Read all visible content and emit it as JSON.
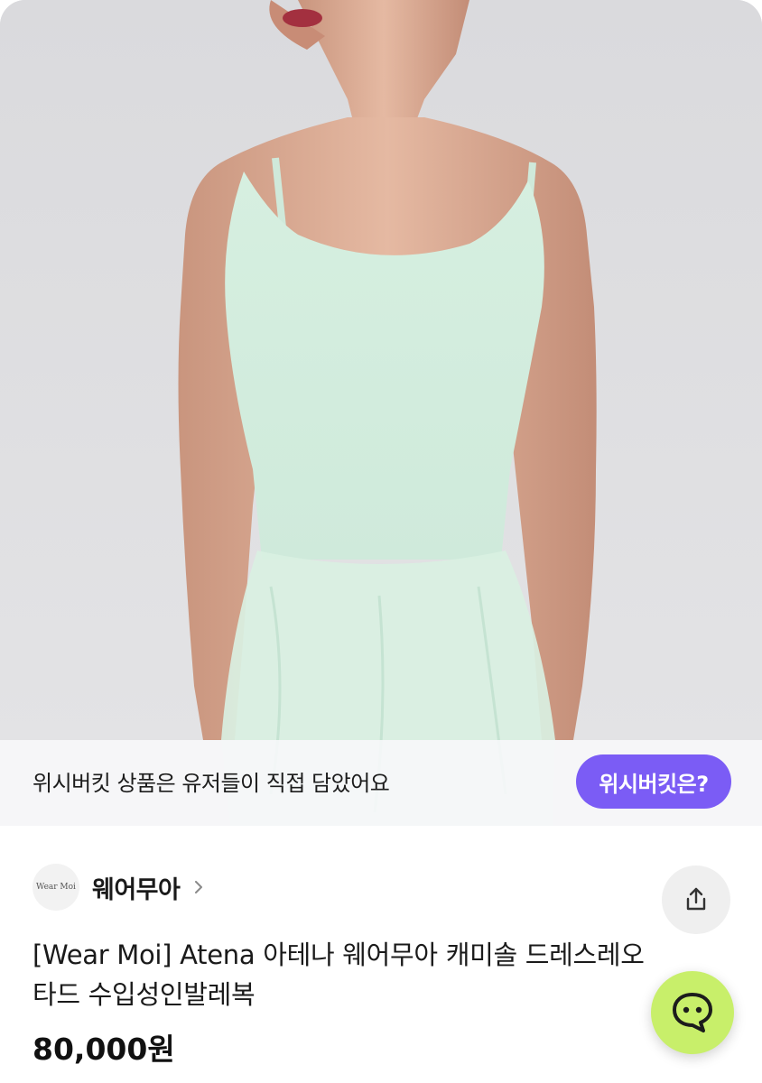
{
  "banner": {
    "text": "위시버킷 상품은 유저들이 직접 담았어요",
    "button_label": "위시버킷은?"
  },
  "shop": {
    "logo_text": "Wear Moi",
    "name": "웨어무아"
  },
  "product": {
    "title": "[Wear Moi] Atena 아테나 웨어무아 캐미솔 드레스레오타드 수입성인발레복",
    "price": "80,000원"
  },
  "icons": {
    "shop_chevron": "chevron-right-icon",
    "share": "share-icon",
    "chat": "chat-bubble-icon"
  },
  "colors": {
    "wish_button": "#7b5cf5",
    "chat_button": "#c8ef6a",
    "leotard": "#d9f0e2"
  }
}
